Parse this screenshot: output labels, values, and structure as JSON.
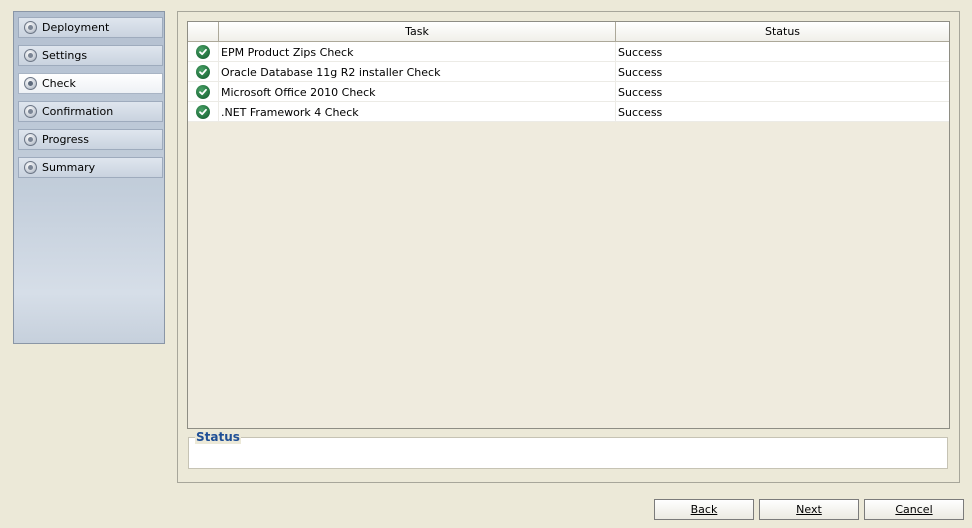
{
  "sidebar": {
    "items": [
      {
        "label": "Deployment",
        "state": "done"
      },
      {
        "label": "Settings",
        "state": "done"
      },
      {
        "label": "Check",
        "state": "active"
      },
      {
        "label": "Confirmation",
        "state": "pending"
      },
      {
        "label": "Progress",
        "state": "pending"
      },
      {
        "label": "Summary",
        "state": "pending"
      }
    ]
  },
  "table": {
    "columns": [
      "",
      "Task",
      "Status"
    ],
    "rows": [
      {
        "icon": "success-check-icon",
        "task": "EPM Product Zips Check",
        "status": "Success"
      },
      {
        "icon": "success-check-icon",
        "task": "Oracle Database 11g R2 installer Check",
        "status": "Success"
      },
      {
        "icon": "success-check-icon",
        "task": "Microsoft Office 2010 Check",
        "status": "Success"
      },
      {
        "icon": "success-check-icon",
        "task": ".NET Framework 4 Check",
        "status": "Success"
      }
    ]
  },
  "status_group": {
    "title": "Status",
    "text": ""
  },
  "buttons": {
    "back": "Back",
    "next": "Next",
    "cancel": "Cancel"
  },
  "colors": {
    "window_bg": "#ece9d8",
    "status_title": "#1f4f96",
    "success_icon": "#1f6e3b"
  }
}
